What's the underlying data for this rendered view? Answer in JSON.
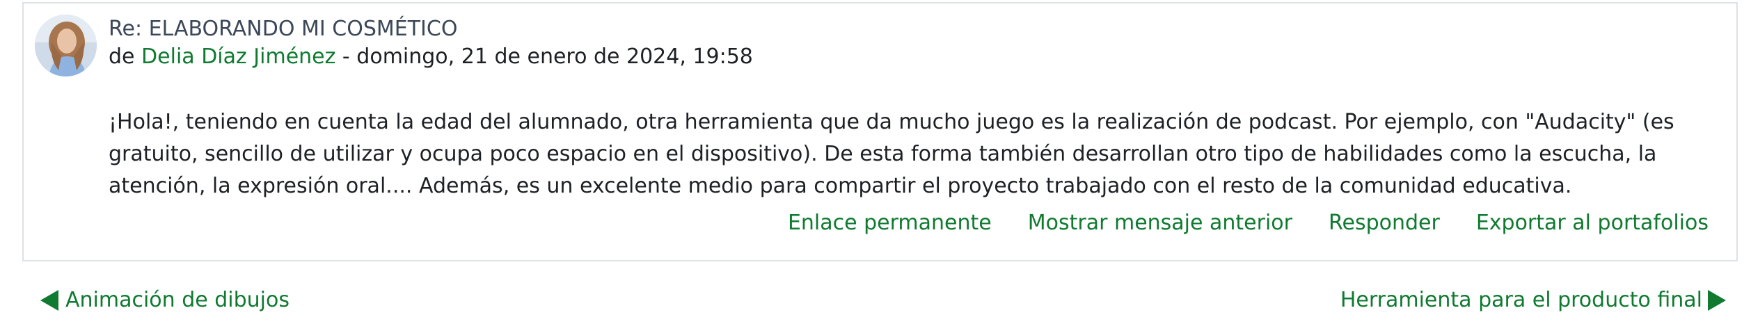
{
  "post": {
    "avatar": {
      "icon": "user-avatar-photo"
    },
    "subject": "Re: ELABORANDO MI COSMÉTICO",
    "byline": {
      "prefix": "de ",
      "author": "Delia Díaz Jiménez",
      "separator": " - ",
      "date": "domingo, 21 de enero de 2024, 19:58"
    },
    "content": "¡Hola!, teniendo en cuenta la edad del alumnado, otra herramienta que da mucho juego es la realización de podcast. Por ejemplo, con \"Audacity\" (es gratuito, sencillo de utilizar y ocupa poco espacio en el dispositivo). De esta forma también desarrollan otro tipo de habilidades como la escucha, la atención, la expresión oral.... Además, es un excelente medio para compartir el proyecto trabajado con el resto de la comunidad educativa.",
    "commands": {
      "permalink": "Enlace permanente",
      "show_parent": "Mostrar mensaje anterior",
      "reply": "Responder",
      "export": "Exportar al portafolios"
    }
  },
  "navigation": {
    "prev": {
      "label": "Animación de dibujos",
      "icon": "triangle-left-icon"
    },
    "next": {
      "label": "Herramienta para el producto final",
      "icon": "triangle-right-icon"
    }
  },
  "colors": {
    "link": "#0f7a30",
    "subject": "#3c4858",
    "text": "#1d2125",
    "border": "#dee2e6"
  }
}
